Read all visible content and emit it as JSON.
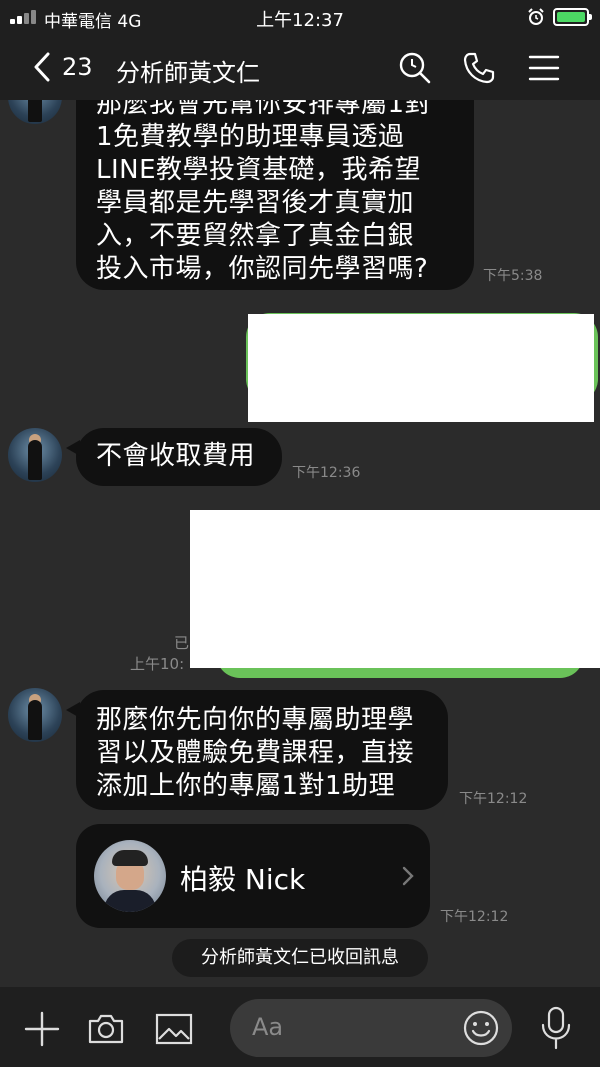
{
  "status_bar": {
    "carrier": "中華電信  4G",
    "time": "上午12:37"
  },
  "header": {
    "back_count": "23",
    "title": "分析師黃文仁",
    "icons": [
      "search-icon",
      "phone-icon",
      "menu-icon"
    ]
  },
  "messages": [
    {
      "sender": "分析師黃文仁",
      "text": "那麼我會先幫你安排專屬1對1免費教學的助理專員透過LINE教學投資基礎，我希望學員都是先學習後才真實加入，不要貿然拿了真金白銀投入市場，你認同先學習嗎?",
      "lines": [
        "那麼我會先幫你安排專屬1對",
        "1免費教學的助理專員透過",
        "LINE教學投資基礎，我希望",
        "學員都是先學習後才真實加",
        "入，不要貿然拿了真金白銀",
        "投入市場，你認同先學習嗎?"
      ],
      "time": "下午5:38"
    },
    {
      "sender": "分析師黃文仁",
      "text": "不會收取費用",
      "time": "下午12:36"
    },
    {
      "sender": "self",
      "partial_read": "已",
      "time": "上午10:"
    },
    {
      "sender": "分析師黃文仁",
      "lines": [
        "那麼你先向你的專屬助理學",
        "習以及體驗免費課程，直接",
        "添加上你的專屬1對1助理"
      ],
      "time": "下午12:12"
    },
    {
      "sender": "分析師黃文仁",
      "contact_card_name": "柏毅 Nick",
      "time": "下午12:12"
    }
  ],
  "system_notice": "分析師黃文仁已收回訊息",
  "input_bar": {
    "placeholder": "Aa",
    "icons": [
      "plus-icon",
      "camera-icon",
      "image-icon",
      "emoji-icon",
      "microphone-icon"
    ]
  }
}
